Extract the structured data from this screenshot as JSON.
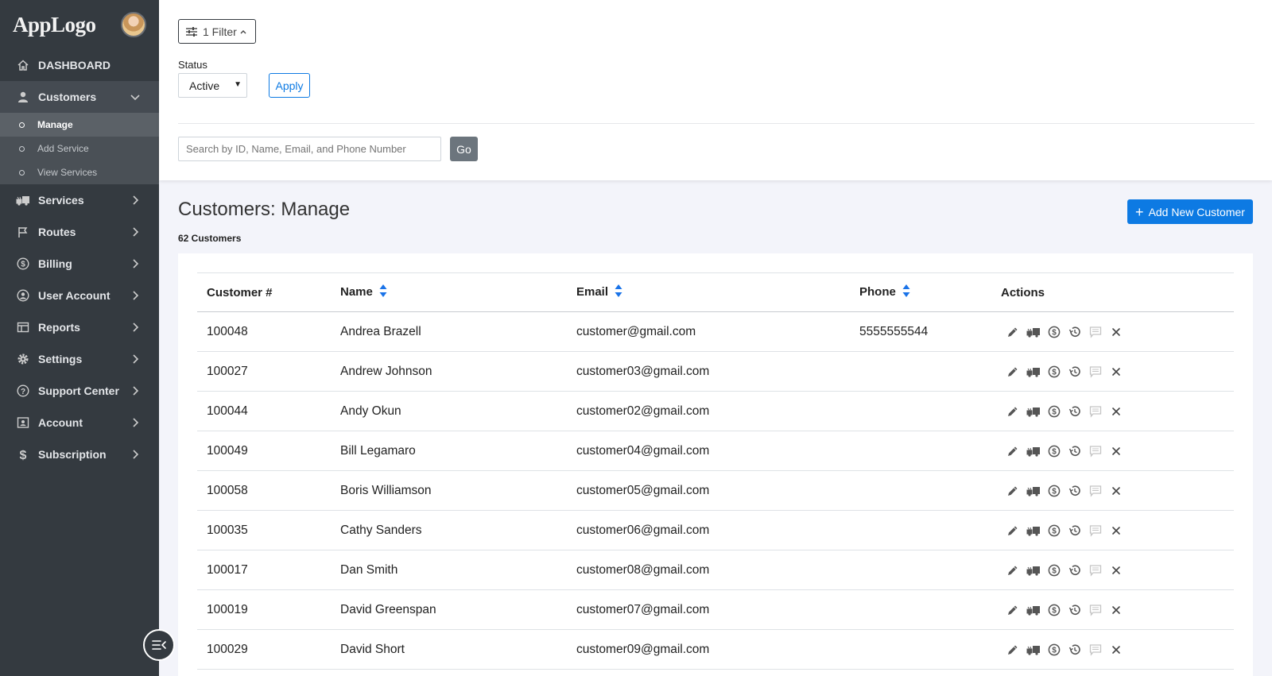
{
  "brand": {
    "logo_text": "AppLogo"
  },
  "sidebar": {
    "items": [
      {
        "label": "DASHBOARD",
        "icon": "home-icon"
      },
      {
        "label": "Customers",
        "icon": "user-icon",
        "expanded": true,
        "children": [
          {
            "label": "Manage",
            "active": true
          },
          {
            "label": "Add Service"
          },
          {
            "label": "View Services"
          }
        ]
      },
      {
        "label": "Services",
        "icon": "truck-icon"
      },
      {
        "label": "Routes",
        "icon": "flag-icon"
      },
      {
        "label": "Billing",
        "icon": "dollar-circle-icon"
      },
      {
        "label": "User Account",
        "icon": "user-circle-icon"
      },
      {
        "label": "Reports",
        "icon": "reports-icon"
      },
      {
        "label": "Settings",
        "icon": "gear-icon"
      },
      {
        "label": "Support Center",
        "icon": "question-icon"
      },
      {
        "label": "Account",
        "icon": "id-card-icon"
      },
      {
        "label": "Subscription",
        "icon": "dollar-icon"
      }
    ]
  },
  "filters": {
    "toggle_label": "1 Filter",
    "status_label": "Status",
    "status_value": "Active",
    "apply_label": "Apply",
    "search_placeholder": "Search by ID, Name, Email, and Phone Number",
    "go_label": "Go"
  },
  "main": {
    "title": "Customers: Manage",
    "count_text": "62 Customers",
    "add_button_label": "Add New Customer"
  },
  "table": {
    "headers": [
      "Customer #",
      "Name",
      "Email",
      "Phone",
      "Actions"
    ],
    "rows": [
      {
        "id": "100048",
        "name": "Andrea Brazell",
        "email": "customer@gmail.com",
        "phone": "5555555544"
      },
      {
        "id": "100027",
        "name": "Andrew Johnson",
        "email": "customer03@gmail.com",
        "phone": ""
      },
      {
        "id": "100044",
        "name": "Andy Okun",
        "email": "customer02@gmail.com",
        "phone": ""
      },
      {
        "id": "100049",
        "name": "Bill Legamaro",
        "email": "customer04@gmail.com",
        "phone": ""
      },
      {
        "id": "100058",
        "name": "Boris Williamson",
        "email": "customer05@gmail.com",
        "phone": ""
      },
      {
        "id": "100035",
        "name": "Cathy Sanders",
        "email": "customer06@gmail.com",
        "phone": ""
      },
      {
        "id": "100017",
        "name": "Dan Smith",
        "email": "customer08@gmail.com",
        "phone": ""
      },
      {
        "id": "100019",
        "name": "David Greenspan",
        "email": "customer07@gmail.com",
        "phone": ""
      },
      {
        "id": "100029",
        "name": "David Short",
        "email": "customer09@gmail.com",
        "phone": ""
      }
    ],
    "row_actions": [
      "edit-icon",
      "truck-icon",
      "billing-icon",
      "history-icon",
      "message-icon",
      "delete-icon"
    ]
  },
  "colors": {
    "sidebar": "#343a40",
    "accent": "#0d7ae3",
    "sort_arrow": "#1a73e8"
  }
}
